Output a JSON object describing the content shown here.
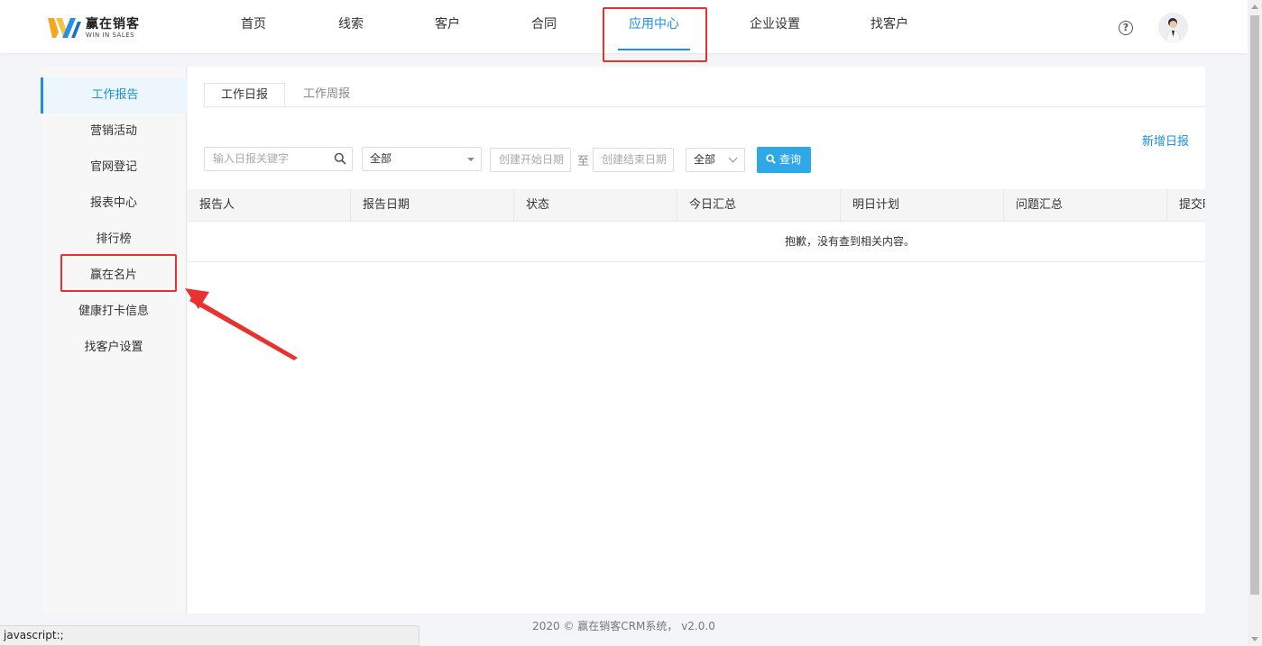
{
  "header": {
    "logo_cn": "赢在销客",
    "logo_en": "WIN IN SALES",
    "nav": [
      {
        "label": "首页"
      },
      {
        "label": "线索"
      },
      {
        "label": "客户"
      },
      {
        "label": "合同"
      },
      {
        "label": "应用中心",
        "active": true
      },
      {
        "label": "企业设置"
      },
      {
        "label": "找客户"
      }
    ],
    "help_glyph": "?"
  },
  "sidebar": {
    "items": [
      {
        "label": "工作报告",
        "active": true
      },
      {
        "label": "营销活动"
      },
      {
        "label": "官网登记"
      },
      {
        "label": "报表中心"
      },
      {
        "label": "排行榜"
      },
      {
        "label": "赢在名片",
        "highlighted": true
      },
      {
        "label": "健康打卡信息"
      },
      {
        "label": "找客户设置"
      }
    ]
  },
  "main": {
    "tabs": [
      {
        "label": "工作日报",
        "active": true
      },
      {
        "label": "工作周报"
      }
    ],
    "new_link": "新增日报",
    "filters": {
      "keyword_placeholder": "输入日报关键字",
      "status_select": "全部",
      "start_date_placeholder": "创建开始日期",
      "to_label": "至",
      "end_date_placeholder": "创建结束日期",
      "scope_select": "全部",
      "query_button": "查询"
    },
    "table": {
      "columns": [
        "报告人",
        "报告日期",
        "状态",
        "今日汇总",
        "明日计划",
        "问题汇总",
        "提交时"
      ],
      "empty_text": "抱歉，没有查到相关内容。"
    }
  },
  "footer": {
    "text": "2020 © 赢在销客CRM系统， v2.0.0"
  },
  "statusbar": {
    "text": "javascript:;"
  },
  "colors": {
    "accent": "#1a8fe3",
    "button": "#2ea8e6",
    "annotation": "#e8322e"
  }
}
